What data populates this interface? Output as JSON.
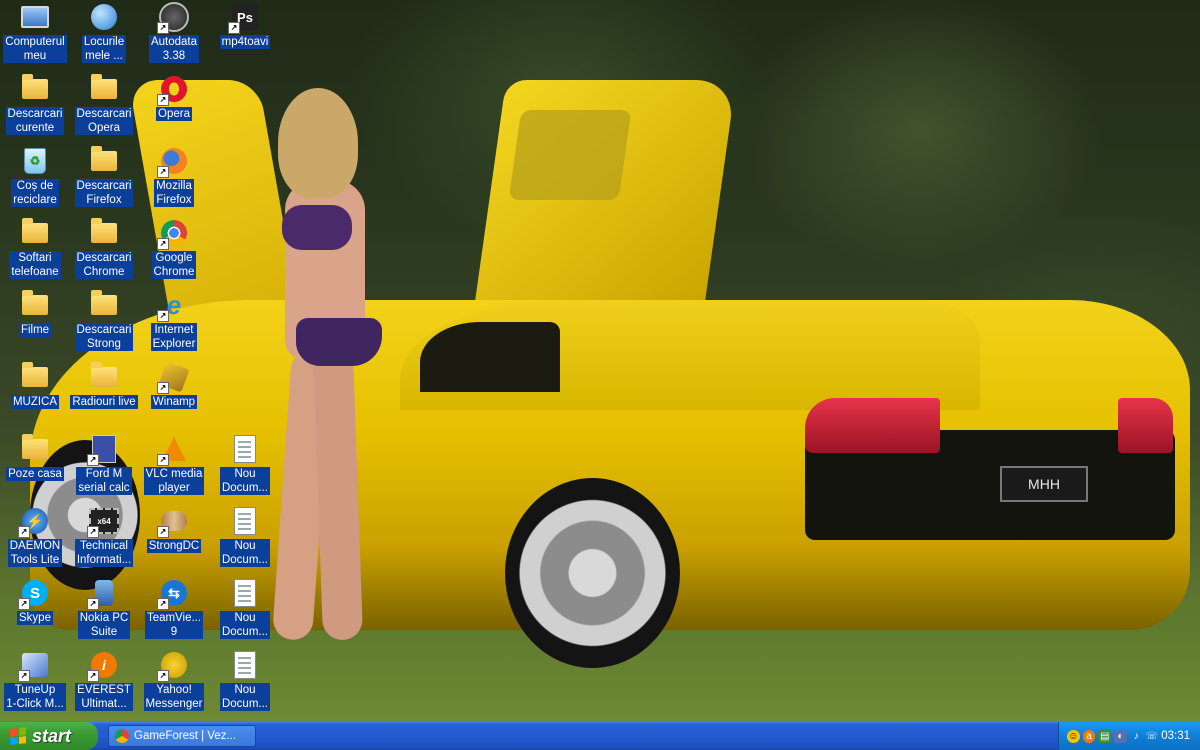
{
  "desktop": {
    "icons": [
      {
        "id": "computer",
        "label": "Computerul\nmeu",
        "icon": "computer-icon"
      },
      {
        "id": "network",
        "label": "Locurile\nmele ...",
        "icon": "network-places-icon"
      },
      {
        "id": "autodata",
        "label": "Autodata\n3.38",
        "icon": "autodata-icon"
      },
      {
        "id": "mp4toavi",
        "label": "mp4toavi",
        "icon": "photoshop-icon"
      },
      {
        "id": "dl-current",
        "label": "Descarcari\ncurente",
        "icon": "folder-icon"
      },
      {
        "id": "dl-opera",
        "label": "Descarcari\nOpera",
        "icon": "folder-icon"
      },
      {
        "id": "opera",
        "label": "Opera",
        "icon": "opera-icon"
      },
      {
        "id": "recycle",
        "label": "Coș de\nreciclare",
        "icon": "recycle-bin-icon"
      },
      {
        "id": "dl-firefox",
        "label": "Descarcari\nFirefox",
        "icon": "folder-icon"
      },
      {
        "id": "firefox",
        "label": "Mozilla\nFirefox",
        "icon": "firefox-icon"
      },
      {
        "id": "softari",
        "label": "Softari\ntelefoane",
        "icon": "folder-icon"
      },
      {
        "id": "dl-chrome",
        "label": "Descarcari\nChrome",
        "icon": "folder-icon"
      },
      {
        "id": "chrome",
        "label": "Google\nChrome",
        "icon": "chrome-icon"
      },
      {
        "id": "filme",
        "label": "Filme",
        "icon": "folder-icon"
      },
      {
        "id": "dl-strong",
        "label": "Descarcari\nStrong",
        "icon": "folder-icon"
      },
      {
        "id": "ie",
        "label": "Internet\nExplorer",
        "icon": "internet-explorer-icon"
      },
      {
        "id": "muzica",
        "label": "MUZICA",
        "icon": "folder-icon"
      },
      {
        "id": "radio",
        "label": "Radiouri live",
        "icon": "folder-icon"
      },
      {
        "id": "winamp",
        "label": "Winamp",
        "icon": "winamp-icon"
      },
      {
        "id": "poze",
        "label": "Poze casa",
        "icon": "folder-icon"
      },
      {
        "id": "fordm",
        "label": "Ford M\nserial calc",
        "icon": "calculator-icon"
      },
      {
        "id": "vlc",
        "label": "VLC media\nplayer",
        "icon": "vlc-icon"
      },
      {
        "id": "nou1",
        "label": "Nou\nDocum...",
        "icon": "text-document-icon"
      },
      {
        "id": "daemon",
        "label": "DAEMON\nTools Lite",
        "icon": "daemon-tools-icon"
      },
      {
        "id": "techinfo",
        "label": "Technical\nInformati...",
        "icon": "chip-icon"
      },
      {
        "id": "strongdc",
        "label": "StrongDC",
        "icon": "strongdc-icon"
      },
      {
        "id": "nou2",
        "label": "Nou\nDocum...",
        "icon": "text-document-icon"
      },
      {
        "id": "skype",
        "label": "Skype",
        "icon": "skype-icon"
      },
      {
        "id": "nokia",
        "label": "Nokia PC\nSuite",
        "icon": "nokia-icon"
      },
      {
        "id": "teamviewer",
        "label": "TeamVie...\n9",
        "icon": "teamviewer-icon"
      },
      {
        "id": "nou3",
        "label": "Nou\nDocum...",
        "icon": "text-document-icon"
      },
      {
        "id": "tuneup",
        "label": "TuneUp\n1-Click M...",
        "icon": "tuneup-icon"
      },
      {
        "id": "everest",
        "label": "EVEREST\nUltimat...",
        "icon": "everest-icon"
      },
      {
        "id": "yahoo",
        "label": "Yahoo!\nMessenger",
        "icon": "yahoo-messenger-icon"
      },
      {
        "id": "nou4",
        "label": "Nou\nDocum...",
        "icon": "text-document-icon"
      }
    ],
    "wallpaper_plate": "MHH"
  },
  "taskbar": {
    "start_label": "start",
    "task": {
      "label": "GameForest | Vez...",
      "icon": "chrome-icon"
    },
    "clock": "03:31",
    "tray_icons": [
      "smiley-icon",
      "avast-icon",
      "network-icon",
      "volume-icon",
      "speaker-icon",
      "phone-icon"
    ]
  },
  "colors": {
    "label_bg": "#0b3f9c",
    "taskbar": "#245ad0",
    "start": "#3c9b34",
    "tray": "#0f7fd8"
  }
}
